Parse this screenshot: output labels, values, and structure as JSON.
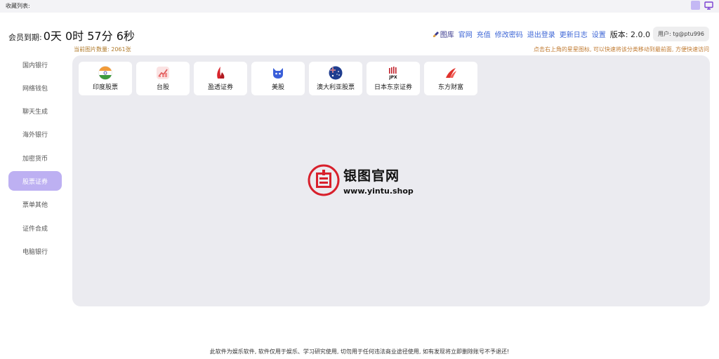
{
  "topbar": {
    "favorites_label": "收藏列表:"
  },
  "membership": {
    "label": "会员到期:",
    "countdown": "0天 0时 57分 6秒"
  },
  "actions": {
    "gallery": "图库",
    "website": "官网",
    "recharge": "充值",
    "change_password": "修改密码",
    "logout": "退出登录",
    "changelog": "更新日志",
    "settings": "设置",
    "version": "版本: 2.0.0",
    "user": "用户: tg@ptu996"
  },
  "info": {
    "image_count": "当前图片数量: 2061张",
    "hint": "点击右上角的星星图标, 可以快速将该分类移动到最前面, 方便快速访问"
  },
  "sidebar": {
    "items": [
      {
        "label": "国内银行"
      },
      {
        "label": "网络钱包"
      },
      {
        "label": "聊天生成"
      },
      {
        "label": "海外银行"
      },
      {
        "label": "加密货币"
      },
      {
        "label": "股票证券"
      },
      {
        "label": "票单其他"
      },
      {
        "label": "证件合成"
      },
      {
        "label": "电脑银行"
      }
    ],
    "active_index": 5
  },
  "cards": [
    {
      "label": "印度股票",
      "icon": "india-flag-icon"
    },
    {
      "label": "台股",
      "icon": "tw-stock-icon"
    },
    {
      "label": "盈透证券",
      "icon": "interactive-brokers-icon"
    },
    {
      "label": "美股",
      "icon": "us-stock-icon"
    },
    {
      "label": "澳大利亚股票",
      "icon": "australia-flag-icon"
    },
    {
      "label": "日本东京证券",
      "icon": "jpx-icon"
    },
    {
      "label": "东方财富",
      "icon": "eastmoney-icon"
    }
  ],
  "watermark": {
    "title": "银图官网",
    "url": "www.yintu.shop"
  },
  "footer": {
    "disclaimer": "此软件为娱乐软件, 软件仅用于娱乐、学习研究使用, 切勿用于任何违法商业途径使用, 如有发现将立即删除账号不予退还!"
  },
  "colors": {
    "accent": "#bdb0f2",
    "link": "#3d66d6",
    "panel": "#ebebf0",
    "warning_text": "#c07a30"
  }
}
